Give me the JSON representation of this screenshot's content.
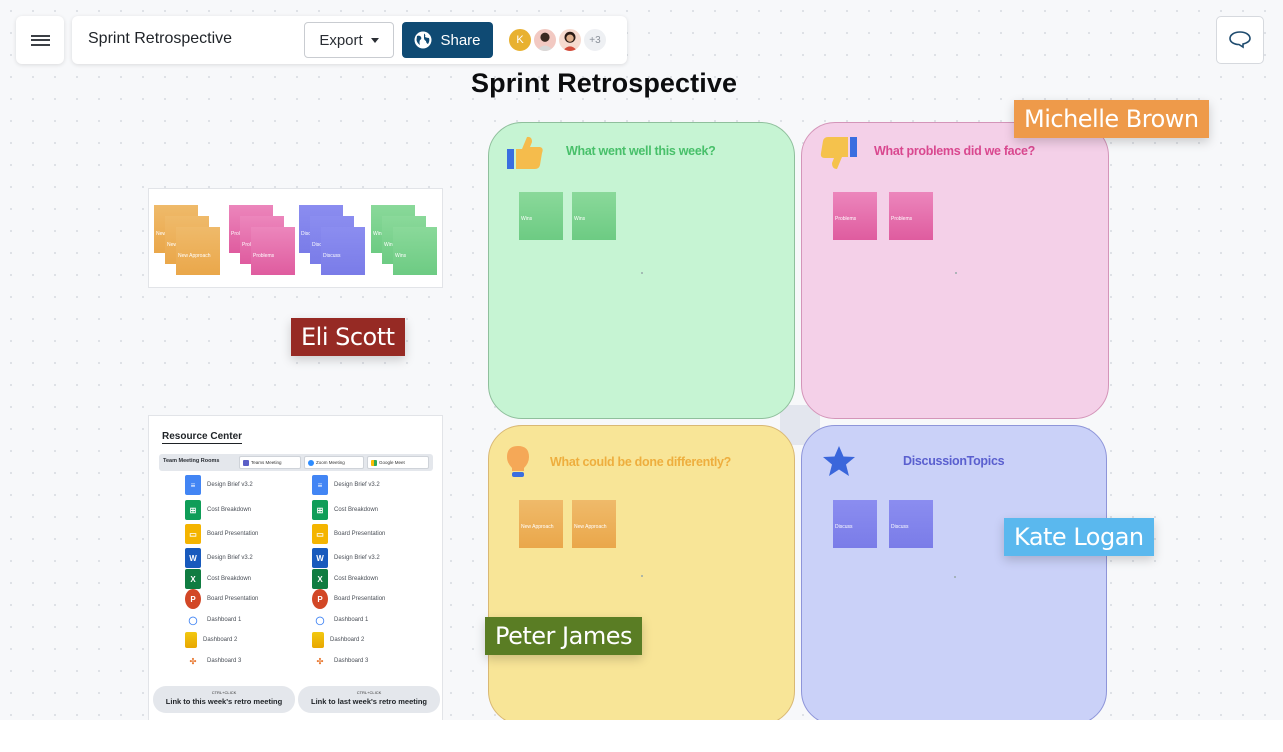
{
  "topbar": {
    "menu_icon": "hamburger-menu-icon",
    "document_title": "Sprint Retrospective",
    "export_label": "Export",
    "share_label": "Share",
    "avatars": [
      {
        "initial": "K",
        "color": "#e8b130"
      },
      {
        "initial": "",
        "color": "#f2c9c2"
      },
      {
        "initial": "",
        "color": "#f6dacf"
      }
    ],
    "more_collaborators": "+3",
    "comment_icon": "speech-bubble-icon"
  },
  "colors": {
    "share_button": "#0f4a73",
    "green_quadrant": "#c6f4d3",
    "pink_quadrant": "#f4d0e8",
    "yellow_quadrant": "#f8e597",
    "blue_quadrant": "#cad1f8"
  },
  "board": {
    "title": "Sprint Retrospective",
    "quadrants": [
      {
        "id": "went-well",
        "title": "What went well this week?",
        "icon": "thumbs-up-icon",
        "stickies": [
          "Wins",
          "Wins"
        ]
      },
      {
        "id": "problems",
        "title": "What problems did we face?",
        "icon": "thumbs-down-icon",
        "stickies": [
          "Problems",
          "Problems"
        ]
      },
      {
        "id": "differently",
        "title": "What could be done differently?",
        "icon": "lightbulb-icon",
        "stickies": [
          "New Approach",
          "New Approach"
        ]
      },
      {
        "id": "discussion",
        "title": "DiscussionTopics",
        "icon": "star-icon",
        "stickies": [
          "Discuss",
          "Discuss"
        ]
      }
    ]
  },
  "sticky_stacks": [
    {
      "color": "orange",
      "labels": [
        "New",
        "New",
        "New Approach"
      ]
    },
    {
      "color": "pink",
      "labels": [
        "Prol",
        "Prol",
        "Problems"
      ]
    },
    {
      "color": "purple",
      "labels": [
        "Disc",
        "Disc",
        "Discuss"
      ]
    },
    {
      "color": "green",
      "labels": [
        "Win",
        "Win",
        "Wins"
      ]
    }
  ],
  "resource_center": {
    "title": "Resource Center",
    "rooms_label": "Team Meeting Rooms",
    "rooms": [
      "Teams Meeting",
      "Zoom Meeting",
      "Google Meet"
    ],
    "files_left": [
      {
        "name": "Design Brief v3.2",
        "icon": "google-docs-icon"
      },
      {
        "name": "Cost Breakdown",
        "icon": "google-sheets-icon"
      },
      {
        "name": "Board Presentation",
        "icon": "google-slides-icon"
      },
      {
        "name": "Design Brief v3.2",
        "icon": "word-icon"
      },
      {
        "name": "Cost Breakdown",
        "icon": "excel-icon"
      },
      {
        "name": "Board Presentation",
        "icon": "powerpoint-icon"
      },
      {
        "name": "Dashboard 1",
        "icon": "looker-icon"
      },
      {
        "name": "Dashboard 2",
        "icon": "power-bi-icon"
      },
      {
        "name": "Dashboard 3",
        "icon": "tableau-icon"
      }
    ],
    "files_right": [
      {
        "name": "Design Brief v3.2",
        "icon": "google-docs-icon"
      },
      {
        "name": "Cost Breakdown",
        "icon": "google-sheets-icon"
      },
      {
        "name": "Board Presentation",
        "icon": "google-slides-icon"
      },
      {
        "name": "Design Brief v3.2",
        "icon": "word-icon"
      },
      {
        "name": "Cost Breakdown",
        "icon": "excel-icon"
      },
      {
        "name": "Board Presentation",
        "icon": "powerpoint-icon"
      },
      {
        "name": "Dashboard 1",
        "icon": "looker-icon"
      },
      {
        "name": "Dashboard 2",
        "icon": "power-bi-icon"
      },
      {
        "name": "Dashboard 3",
        "icon": "tableau-icon"
      }
    ],
    "links": [
      {
        "hint": "CTRL+CLICK",
        "label": "Link to this week's retro meeting"
      },
      {
        "hint": "CTRL+CLICK",
        "label": "Link to last week's retro meeting"
      }
    ]
  },
  "cursors": [
    {
      "name": "Michelle Brown",
      "color": "#ee9a4a"
    },
    {
      "name": "Eli Scott",
      "color": "#962a24"
    },
    {
      "name": "Kate Logan",
      "color": "#5ab8ee"
    },
    {
      "name": "Peter James",
      "color": "#5a7d24"
    }
  ]
}
